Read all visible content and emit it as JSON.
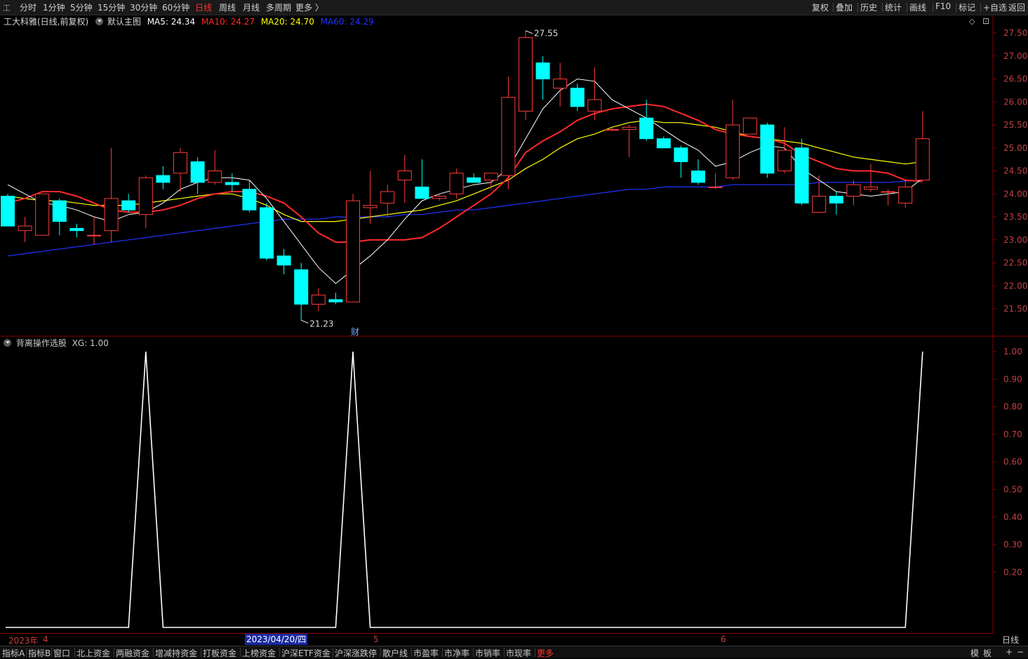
{
  "topbar": {
    "timeframes": [
      {
        "label": "分时",
        "active": false
      },
      {
        "label": "1分钟",
        "active": false
      },
      {
        "label": "5分钟",
        "active": false
      },
      {
        "label": "15分钟",
        "active": false
      },
      {
        "label": "30分钟",
        "active": false
      },
      {
        "label": "60分钟",
        "active": false
      },
      {
        "label": "日线",
        "active": true
      },
      {
        "label": "周线",
        "active": false
      },
      {
        "label": "月线",
        "active": false
      },
      {
        "label": "多周期",
        "active": false
      },
      {
        "label": "更多 〉",
        "active": false
      }
    ],
    "tools": [
      "复权",
      "叠加",
      "历史",
      "统计",
      "画线",
      "F10",
      "标记",
      "+自选",
      "返回"
    ]
  },
  "legend": {
    "stock": "工大科雅(日线,前复权)",
    "template": "默认主图",
    "ma5": "MA5: 24.34",
    "ma10": "MA10: 24.27",
    "ma20": "MA20: 24.70",
    "ma60": "MA60: 24.29",
    "colors": {
      "ma5": "#ffffff",
      "ma10": "#ff2a2a",
      "ma20": "#ffff00",
      "ma60": "#2233ff"
    }
  },
  "indicator": {
    "name": "背离操作选股",
    "value": "XG: 1.00"
  },
  "annotations": {
    "high": "27.55",
    "low": "21.23",
    "fin": "财"
  },
  "dates": {
    "year": "2023年",
    "m4": "4",
    "cursor": "2023/04/20/四",
    "m5": "5",
    "m6": "6"
  },
  "period_label": "日线",
  "bottombar": {
    "tabs": [
      "指标A",
      "指标B",
      "窗口",
      "北上资金",
      "两融资金",
      "增减持资金",
      "打板资金",
      "上榜资金",
      "沪深ETF资金",
      "沪深涨跌停",
      "散户线",
      "市盈率",
      "市净率",
      "市销率",
      "市现率",
      "更多"
    ],
    "right": [
      "模",
      "板",
      "+",
      "−"
    ]
  },
  "chart_data": {
    "type": "candlestick",
    "price_axis": {
      "min": 21.0,
      "max": 27.75,
      "ticks": [
        21.5,
        22.0,
        22.5,
        23.0,
        23.5,
        24.0,
        24.5,
        25.0,
        25.5,
        26.0,
        26.5,
        27.0,
        27.5
      ]
    },
    "candles": [
      {
        "o": 23.95,
        "h": 24.0,
        "l": 23.3,
        "c": 23.3
      },
      {
        "o": 23.2,
        "h": 23.5,
        "l": 22.95,
        "c": 23.3
      },
      {
        "o": 23.1,
        "h": 24.0,
        "l": 23.1,
        "c": 24.0
      },
      {
        "o": 23.85,
        "h": 23.9,
        "l": 23.1,
        "c": 23.4
      },
      {
        "o": 23.25,
        "h": 23.35,
        "l": 23.05,
        "c": 23.2
      },
      {
        "o": 23.1,
        "h": 23.5,
        "l": 22.9,
        "c": 23.1
      },
      {
        "o": 23.2,
        "h": 25.0,
        "l": 22.95,
        "c": 23.9
      },
      {
        "o": 23.85,
        "h": 24.0,
        "l": 23.6,
        "c": 23.65
      },
      {
        "o": 23.55,
        "h": 24.4,
        "l": 23.25,
        "c": 24.35
      },
      {
        "o": 24.4,
        "h": 24.6,
        "l": 24.1,
        "c": 24.25
      },
      {
        "o": 24.45,
        "h": 25.0,
        "l": 24.05,
        "c": 24.9
      },
      {
        "o": 24.7,
        "h": 24.8,
        "l": 24.0,
        "c": 24.25
      },
      {
        "o": 24.25,
        "h": 24.95,
        "l": 24.2,
        "c": 24.5
      },
      {
        "o": 24.25,
        "h": 24.45,
        "l": 24.05,
        "c": 24.2
      },
      {
        "o": 24.1,
        "h": 24.3,
        "l": 23.6,
        "c": 23.65
      },
      {
        "o": 23.7,
        "h": 23.8,
        "l": 22.55,
        "c": 22.6
      },
      {
        "o": 22.65,
        "h": 22.8,
        "l": 22.25,
        "c": 22.45
      },
      {
        "o": 22.35,
        "h": 22.5,
        "l": 21.25,
        "c": 21.6
      },
      {
        "o": 21.6,
        "h": 21.95,
        "l": 21.45,
        "c": 21.8
      },
      {
        "o": 21.7,
        "h": 21.85,
        "l": 21.6,
        "c": 21.65
      },
      {
        "o": 21.65,
        "h": 24.0,
        "l": 21.65,
        "c": 23.85
      },
      {
        "o": 23.7,
        "h": 24.5,
        "l": 23.35,
        "c": 23.75
      },
      {
        "o": 23.8,
        "h": 24.2,
        "l": 23.5,
        "c": 24.05
      },
      {
        "o": 24.3,
        "h": 24.85,
        "l": 23.8,
        "c": 24.5
      },
      {
        "o": 24.15,
        "h": 24.75,
        "l": 23.95,
        "c": 23.9
      },
      {
        "o": 23.9,
        "h": 24.0,
        "l": 23.85,
        "c": 23.95
      },
      {
        "o": 24.0,
        "h": 24.55,
        "l": 23.9,
        "c": 24.45
      },
      {
        "o": 24.35,
        "h": 24.45,
        "l": 24.25,
        "c": 24.25
      },
      {
        "o": 24.3,
        "h": 24.45,
        "l": 24.1,
        "c": 24.45
      },
      {
        "o": 24.4,
        "h": 26.55,
        "l": 24.1,
        "c": 26.1
      },
      {
        "o": 25.8,
        "h": 27.55,
        "l": 25.6,
        "c": 27.4
      },
      {
        "o": 26.85,
        "h": 27.0,
        "l": 26.05,
        "c": 26.5
      },
      {
        "o": 26.3,
        "h": 26.85,
        "l": 25.9,
        "c": 26.5
      },
      {
        "o": 26.3,
        "h": 26.4,
        "l": 25.8,
        "c": 25.9
      },
      {
        "o": 25.8,
        "h": 26.75,
        "l": 25.6,
        "c": 26.05
      },
      {
        "o": 25.4,
        "h": 25.45,
        "l": 25.4,
        "c": 25.4
      },
      {
        "o": 25.4,
        "h": 25.5,
        "l": 24.8,
        "c": 25.45
      },
      {
        "o": 25.65,
        "h": 26.05,
        "l": 25.15,
        "c": 25.2
      },
      {
        "o": 25.2,
        "h": 25.25,
        "l": 25.0,
        "c": 25.0
      },
      {
        "o": 25.0,
        "h": 25.05,
        "l": 24.35,
        "c": 24.7
      },
      {
        "o": 24.5,
        "h": 24.75,
        "l": 24.2,
        "c": 24.25
      },
      {
        "o": 24.15,
        "h": 24.45,
        "l": 24.1,
        "c": 24.15
      },
      {
        "o": 24.35,
        "h": 26.05,
        "l": 24.3,
        "c": 25.5
      },
      {
        "o": 25.3,
        "h": 25.65,
        "l": 25.3,
        "c": 25.65
      },
      {
        "o": 25.5,
        "h": 25.55,
        "l": 24.35,
        "c": 24.45
      },
      {
        "o": 24.5,
        "h": 25.45,
        "l": 24.45,
        "c": 24.95
      },
      {
        "o": 25.0,
        "h": 25.2,
        "l": 23.75,
        "c": 23.8
      },
      {
        "o": 23.6,
        "h": 24.4,
        "l": 23.6,
        "c": 23.95
      },
      {
        "o": 23.95,
        "h": 24.05,
        "l": 23.55,
        "c": 23.8
      },
      {
        "o": 23.95,
        "h": 24.3,
        "l": 23.75,
        "c": 24.2
      },
      {
        "o": 24.1,
        "h": 24.65,
        "l": 24.05,
        "c": 24.15
      },
      {
        "o": 24.05,
        "h": 24.1,
        "l": 23.75,
        "c": 24.05
      },
      {
        "o": 23.8,
        "h": 24.3,
        "l": 23.7,
        "c": 24.15
      },
      {
        "o": 24.3,
        "h": 25.8,
        "l": 24.3,
        "c": 25.2
      }
    ],
    "ma5": [
      24.2,
      24.0,
      23.8,
      23.75,
      23.65,
      23.5,
      23.4,
      23.55,
      23.6,
      23.8,
      24.1,
      24.25,
      24.35,
      24.35,
      24.3,
      23.9,
      23.4,
      22.9,
      22.4,
      22.05,
      22.35,
      22.65,
      23.0,
      23.45,
      23.85,
      24.0,
      24.1,
      24.2,
      24.25,
      24.55,
      25.2,
      25.85,
      26.25,
      26.5,
      26.45,
      26.05,
      25.85,
      25.65,
      25.4,
      25.15,
      24.95,
      24.6,
      24.7,
      24.9,
      25.05,
      25.0,
      24.55,
      24.3,
      24.05,
      24.0,
      23.95,
      24.0,
      24.05,
      24.34
    ],
    "ma10": [
      23.8,
      23.9,
      24.05,
      24.05,
      23.95,
      23.8,
      23.65,
      23.6,
      23.6,
      23.65,
      23.75,
      23.9,
      24.0,
      24.05,
      24.05,
      23.95,
      23.8,
      23.5,
      23.15,
      22.95,
      22.95,
      23.0,
      23.0,
      23.0,
      23.05,
      23.25,
      23.5,
      23.75,
      24.0,
      24.35,
      24.9,
      25.15,
      25.35,
      25.6,
      25.75,
      25.85,
      25.9,
      25.95,
      25.9,
      25.75,
      25.6,
      25.4,
      25.3,
      25.25,
      25.2,
      25.1,
      24.85,
      24.7,
      24.55,
      24.5,
      24.5,
      24.45,
      24.3,
      24.27
    ],
    "ma20": [
      23.95,
      23.9,
      23.85,
      23.85,
      23.8,
      23.75,
      23.75,
      23.75,
      23.8,
      23.85,
      23.9,
      23.95,
      24.0,
      24.0,
      23.9,
      23.75,
      23.55,
      23.4,
      23.4,
      23.4,
      23.45,
      23.5,
      23.55,
      23.6,
      23.65,
      23.75,
      23.85,
      24.0,
      24.15,
      24.3,
      24.55,
      24.75,
      25.0,
      25.2,
      25.3,
      25.45,
      25.55,
      25.6,
      25.55,
      25.55,
      25.5,
      25.45,
      25.35,
      25.25,
      25.2,
      25.15,
      25.1,
      25.0,
      24.9,
      24.8,
      24.75,
      24.7,
      24.65,
      24.7
    ],
    "ma60": [
      22.65,
      22.7,
      22.75,
      22.8,
      22.85,
      22.9,
      22.95,
      23.0,
      23.05,
      23.1,
      23.15,
      23.2,
      23.25,
      23.3,
      23.35,
      23.4,
      23.45,
      23.45,
      23.45,
      23.5,
      23.5,
      23.5,
      23.5,
      23.55,
      23.55,
      23.6,
      23.65,
      23.65,
      23.7,
      23.75,
      23.8,
      23.85,
      23.9,
      23.95,
      24.0,
      24.05,
      24.1,
      24.1,
      24.15,
      24.15,
      24.15,
      24.15,
      24.2,
      24.2,
      24.2,
      24.2,
      24.2,
      24.25,
      24.25,
      24.25,
      24.25,
      24.25,
      24.28,
      24.29
    ],
    "indicator": {
      "name": "XG",
      "axis": {
        "min": 0.0,
        "max": 1.0,
        "ticks": [
          0.2,
          0.3,
          0.4,
          0.5,
          0.6,
          0.7,
          0.8,
          0.9,
          1.0
        ]
      },
      "values": [
        0,
        0,
        0,
        0,
        0,
        0,
        0,
        0,
        1,
        0,
        0,
        0,
        0,
        0,
        0,
        0,
        0,
        0,
        0,
        0,
        1,
        0,
        0,
        0,
        0,
        0,
        0,
        0,
        0,
        0,
        0,
        0,
        0,
        0,
        0,
        0,
        0,
        0,
        0,
        0,
        0,
        0,
        0,
        0,
        0,
        0,
        0,
        0,
        0,
        0,
        0,
        0,
        0,
        1
      ]
    }
  }
}
